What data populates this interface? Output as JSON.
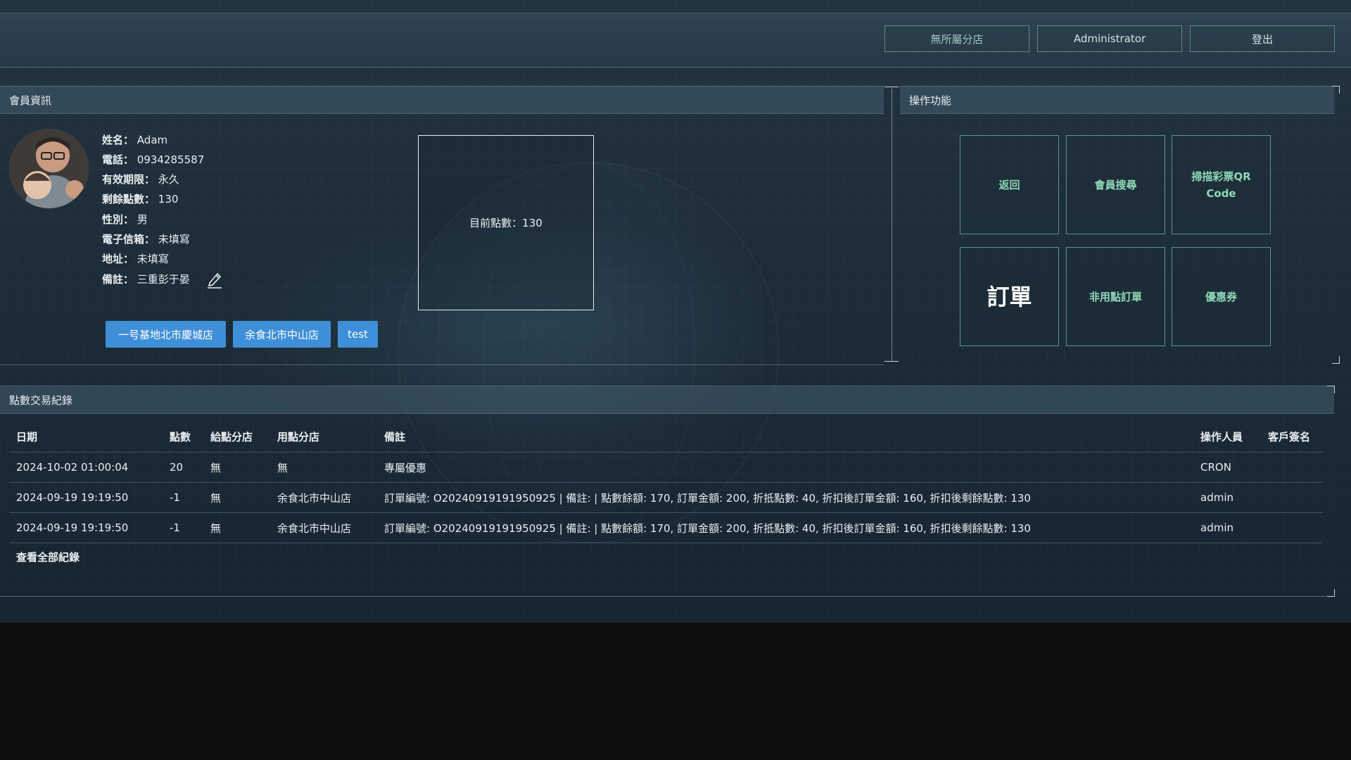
{
  "header": {
    "branch_label": "無所屬分店",
    "user_label": "Administrator",
    "logout_label": "登出"
  },
  "member_panel": {
    "title": "會員資訊",
    "fields": [
      {
        "label": "姓名：",
        "value": "Adam"
      },
      {
        "label": "電話：",
        "value": "0934285587"
      },
      {
        "label": "有效期限：",
        "value": "永久"
      },
      {
        "label": "剩餘點數：",
        "value": "130"
      },
      {
        "label": "性別：",
        "value": "男"
      },
      {
        "label": "電子信箱：",
        "value": "未填寫"
      },
      {
        "label": "地址：",
        "value": "未填寫"
      },
      {
        "label": "備註：",
        "value": "三重彭于晏"
      }
    ],
    "stores": [
      "一号基地北市慶城店",
      "余食北市中山店",
      "test"
    ],
    "points_box": "目前點數：130"
  },
  "operations": {
    "title": "操作功能",
    "buttons": [
      "返回",
      "會員搜尋",
      "掃描彩票QR Code",
      "訂單",
      "非用點訂單",
      "優惠券"
    ]
  },
  "transactions": {
    "title": "點數交易紀錄",
    "columns": [
      "日期",
      "點數",
      "給點分店",
      "用點分店",
      "備註",
      "操作人員",
      "客戶簽名"
    ],
    "rows": [
      [
        "2024-10-02 01:00:04",
        "20",
        "無",
        "無",
        "專屬優惠",
        "CRON",
        ""
      ],
      [
        "2024-09-19 19:19:50",
        "-1",
        "無",
        "余食北市中山店",
        "訂單編號: O20240919191950925 | 備註: | 點數餘額: 170, 訂單金額: 200, 折抵點數: 40, 折扣後訂單金額: 160, 折扣後剩餘點數: 130",
        "admin",
        ""
      ],
      [
        "2024-09-19 19:19:50",
        "-1",
        "無",
        "余食北市中山店",
        "訂單編號: O20240919191950925 | 備註: | 點數餘額: 170, 訂單金額: 200, 折抵點數: 40, 折扣後訂單金額: 160, 折扣後剩餘點數: 130",
        "admin",
        ""
      ]
    ],
    "view_all": "查看全部紀錄"
  }
}
